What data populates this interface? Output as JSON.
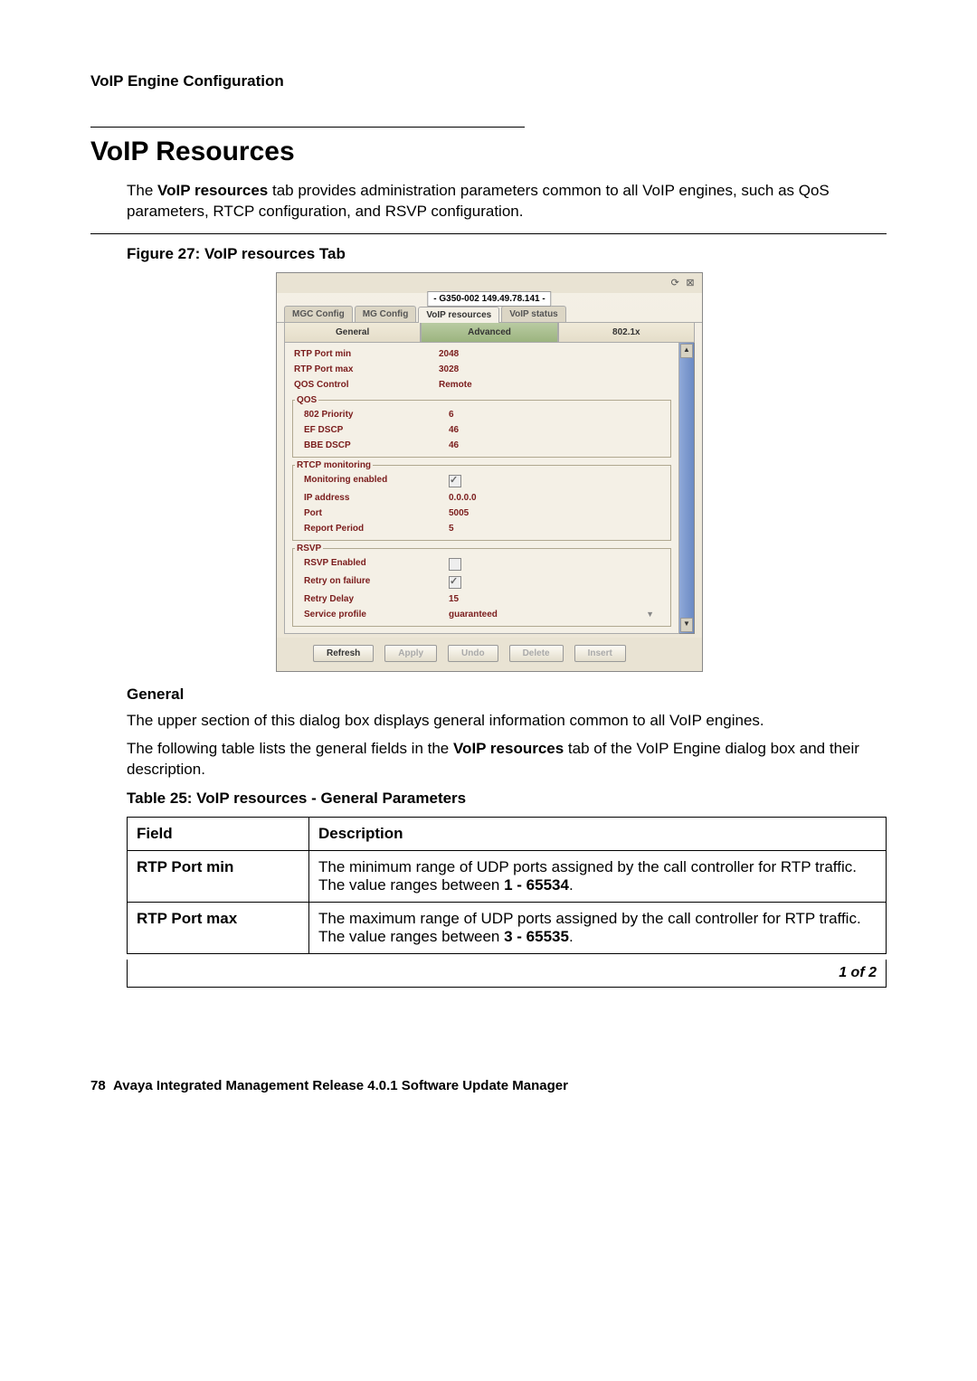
{
  "running_header": "VoIP Engine Configuration",
  "section_title": "VoIP Resources",
  "intro_pre": "The ",
  "intro_bold": "VoIP resources",
  "intro_post": " tab provides administration parameters common to all VoIP engines, such as QoS parameters, RTCP configuration, and RSVP configuration.",
  "figure_caption": "Figure 27: VoIP resources Tab",
  "screenshot": {
    "device_id": "- G350-002 149.49.78.141 -",
    "tabs": {
      "mgc_config": "MGC Config",
      "mg_config": "MG Config",
      "voip_resources": "VoIP resources",
      "voip_status": "VoIP status"
    },
    "subtabs": {
      "general": "General",
      "advanced": "Advanced",
      "x8021": "802.1x"
    },
    "fields": {
      "rtp_port_min_label": "RTP Port min",
      "rtp_port_min_value": "2048",
      "rtp_port_max_label": "RTP Port max",
      "rtp_port_max_value": "3028",
      "qos_control_label": "QOS Control",
      "qos_control_value": "Remote"
    },
    "qos_group": {
      "legend": "QOS",
      "priority_label": "802 Priority",
      "priority_value": "6",
      "ef_dscp_label": "EF DSCP",
      "ef_dscp_value": "46",
      "bbe_dscp_label": "BBE DSCP",
      "bbe_dscp_value": "46"
    },
    "rtcp_group": {
      "legend": "RTCP monitoring",
      "mon_enabled_label": "Monitoring enabled",
      "ip_label": "IP address",
      "ip_value": "0.0.0.0",
      "port_label": "Port",
      "port_value": "5005",
      "report_label": "Report Period",
      "report_value": "5"
    },
    "rsvp_group": {
      "legend": "RSVP",
      "enabled_label": "RSVP Enabled",
      "retry_fail_label": "Retry on failure",
      "retry_delay_label": "Retry Delay",
      "retry_delay_value": "15",
      "service_profile_label": "Service profile",
      "service_profile_value": "guaranteed"
    },
    "buttons": {
      "refresh": "Refresh",
      "apply": "Apply",
      "undo": "Undo",
      "delete": "Delete",
      "insert": "Insert"
    }
  },
  "general_subhead": "General",
  "general_p1": "The upper section of this dialog box displays general information common to all VoIP engines.",
  "general_p2_pre": "The following table lists the general fields in the ",
  "general_p2_bold": "VoIP resources",
  "general_p2_post": " tab of the VoIP Engine dialog box and their description.",
  "table_caption": "Table 25: VoIP resources - General Parameters",
  "table": {
    "h_field": "Field",
    "h_desc": "Description",
    "r1_field": "RTP Port min",
    "r1_desc_pre": "The minimum range of UDP ports assigned by the call controller for RTP traffic. The value ranges between ",
    "r1_desc_bold": "1 - 65534",
    "r1_desc_post": ".",
    "r2_field": "RTP Port max",
    "r2_desc_pre": "The maximum range of UDP ports assigned by the call controller for RTP traffic. The value ranges between ",
    "r2_desc_bold": "3 - 65535",
    "r2_desc_post": ".",
    "pager": "1 of 2"
  },
  "footer_page": "78",
  "footer_text": "Avaya Integrated Management Release 4.0.1 Software Update Manager"
}
